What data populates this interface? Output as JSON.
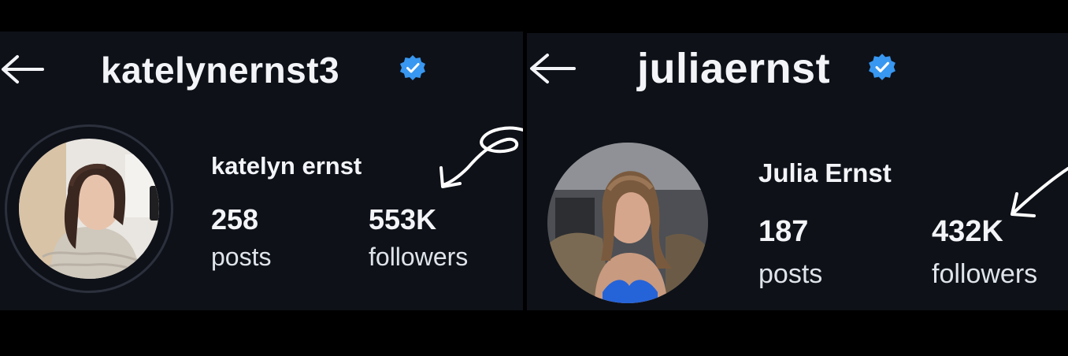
{
  "profiles": [
    {
      "username": "katelynernst3",
      "display_name": "katelyn ernst",
      "verified": true,
      "posts_count": "258",
      "posts_label": "posts",
      "followers_count": "553K",
      "followers_label": "followers"
    },
    {
      "username": "juliaernst",
      "display_name": "Julia Ernst",
      "verified": true,
      "posts_count": "187",
      "posts_label": "posts",
      "followers_count": "432K",
      "followers_label": "followers"
    }
  ],
  "colors": {
    "background": "#0e1118",
    "text": "#f2f4f8",
    "verified_badge": "#3897f0",
    "doodle": "#ffffff"
  },
  "icons": {
    "back": "arrow-left-icon",
    "verified": "verified-badge-icon",
    "annotation": "hand-drawn-arrow-icon"
  }
}
